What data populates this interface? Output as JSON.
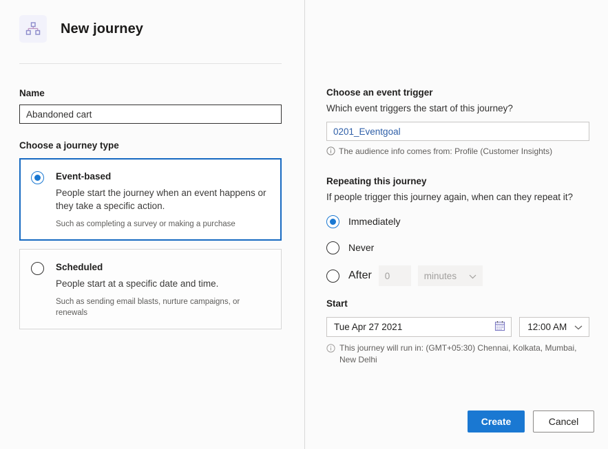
{
  "header": {
    "icon": "hierarchy-icon",
    "title": "New journey"
  },
  "left": {
    "name": {
      "label": "Name",
      "value": "Abandoned cart"
    },
    "journey_type": {
      "label": "Choose a journey type",
      "options": [
        {
          "title": "Event-based",
          "description": "People start the journey when an event happens or they take a specific action.",
          "hint": "Such as completing a survey or making a purchase",
          "selected": true
        },
        {
          "title": "Scheduled",
          "description": "People start at a specific date and time.",
          "hint": "Such as sending email blasts, nurture campaigns, or renewals",
          "selected": false
        }
      ]
    }
  },
  "right": {
    "trigger": {
      "heading": "Choose an event trigger",
      "subheading": "Which event triggers the start of this journey?",
      "value": "0201_Eventgoal",
      "info": "The audience info comes from: Profile (Customer Insights)"
    },
    "repeating": {
      "heading": "Repeating this journey",
      "subheading": "If people trigger this journey again, when can they repeat it?",
      "options": [
        {
          "label": "Immediately",
          "selected": true
        },
        {
          "label": "Never",
          "selected": false
        },
        {
          "label": "After",
          "selected": false
        }
      ],
      "after_amount": "0",
      "after_unit": "minutes"
    },
    "start": {
      "label": "Start",
      "date": "Tue Apr 27 2021",
      "time": "12:00 AM",
      "timezone_note": "This journey will run in: (GMT+05:30) Chennai, Kolkata, Mumbai, New Delhi"
    }
  },
  "footer": {
    "create_label": "Create",
    "cancel_label": "Cancel"
  },
  "colors": {
    "accent_blue": "#1a78d2",
    "selected_border": "#1669c1",
    "link_blue": "#2f5fa8",
    "icon_purple": "#8a8acb",
    "disabled_bg": "#f3f2f1",
    "page_bg": "#fbfbfb"
  }
}
